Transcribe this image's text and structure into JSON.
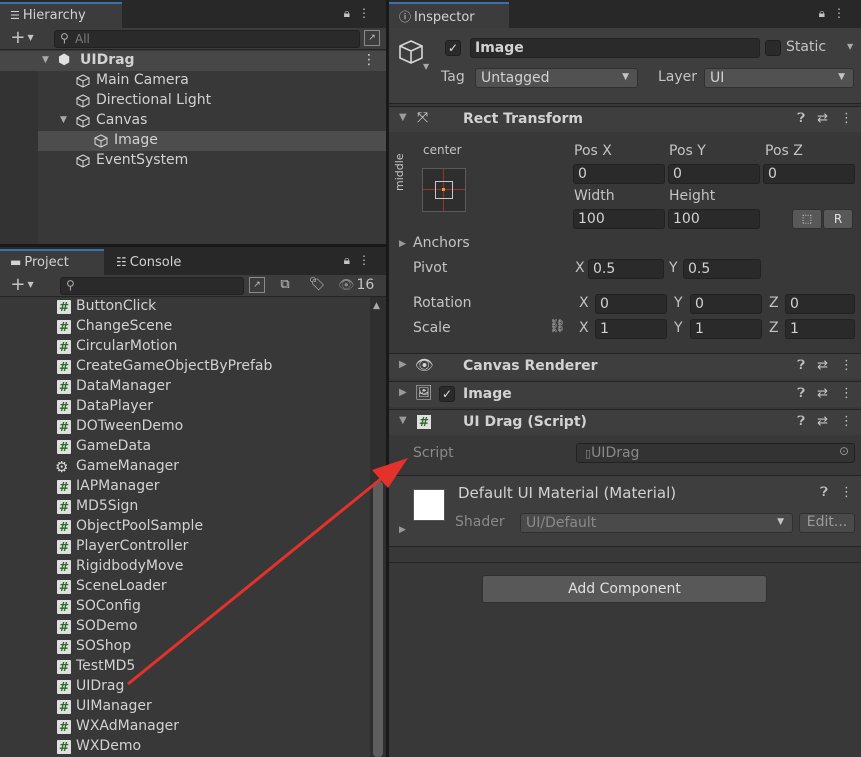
{
  "colors": {
    "selection": "#4d4d4d",
    "tab_accent": "#3a72b0",
    "arrow": "#e3312b",
    "script_icon_green": "#2a6b2a"
  },
  "hierarchy": {
    "tab_label": "Hierarchy",
    "search_placeholder": "All",
    "add_label": "+",
    "scene_name": "UIDrag",
    "items": [
      {
        "label": "Main Camera",
        "icon": "gameobject-cube-icon"
      },
      {
        "label": "Directional Light",
        "icon": "gameobject-cube-icon"
      },
      {
        "label": "Canvas",
        "icon": "gameobject-cube-icon"
      },
      {
        "label": "Image",
        "icon": "gameobject-cube-icon"
      },
      {
        "label": "EventSystem",
        "icon": "gameobject-cube-icon"
      }
    ]
  },
  "project": {
    "tab_label": "Project",
    "console_tab_label": "Console",
    "hidden_count": "16",
    "add_label": "+",
    "files": [
      {
        "label": "ButtonClick",
        "icon": "csharp-script-icon"
      },
      {
        "label": "ChangeScene",
        "icon": "csharp-script-icon"
      },
      {
        "label": "CircularMotion",
        "icon": "csharp-script-icon"
      },
      {
        "label": "CreateGameObjectByPrefab",
        "icon": "csharp-script-icon"
      },
      {
        "label": "DataManager",
        "icon": "csharp-script-icon"
      },
      {
        "label": "DataPlayer",
        "icon": "csharp-script-icon"
      },
      {
        "label": "DOTweenDemo",
        "icon": "csharp-script-icon"
      },
      {
        "label": "GameData",
        "icon": "csharp-script-icon"
      },
      {
        "label": "GameManager",
        "icon": "gear-icon"
      },
      {
        "label": "IAPManager",
        "icon": "csharp-script-icon"
      },
      {
        "label": "MD5Sign",
        "icon": "csharp-script-icon"
      },
      {
        "label": "ObjectPoolSample",
        "icon": "csharp-script-icon"
      },
      {
        "label": "PlayerController",
        "icon": "csharp-script-icon"
      },
      {
        "label": "RigidbodyMove",
        "icon": "csharp-script-icon"
      },
      {
        "label": "SceneLoader",
        "icon": "csharp-script-icon"
      },
      {
        "label": "SOConfig",
        "icon": "csharp-script-icon"
      },
      {
        "label": "SODemo",
        "icon": "csharp-script-icon"
      },
      {
        "label": "SOShop",
        "icon": "csharp-script-icon"
      },
      {
        "label": "TestMD5",
        "icon": "csharp-script-icon"
      },
      {
        "label": "UIDrag",
        "icon": "csharp-script-icon"
      },
      {
        "label": "UIManager",
        "icon": "csharp-script-icon"
      },
      {
        "label": "WXAdManager",
        "icon": "csharp-script-icon"
      },
      {
        "label": "WXDemo",
        "icon": "csharp-script-icon"
      }
    ]
  },
  "inspector": {
    "tab_label": "Inspector",
    "object_name": "Image",
    "static_label": "Static",
    "tag_label": "Tag",
    "tag_value": "Untagged",
    "layer_label": "Layer",
    "layer_value": "UI",
    "rect_transform": {
      "title": "Rect Transform",
      "anchor_h": "center",
      "anchor_v": "middle",
      "pos_x_label": "Pos X",
      "pos_x": "0",
      "pos_y_label": "Pos Y",
      "pos_y": "0",
      "pos_z_label": "Pos Z",
      "pos_z": "0",
      "width_label": "Width",
      "width": "100",
      "height_label": "Height",
      "height": "100",
      "r_button": "R",
      "anchors_label": "Anchors",
      "pivot_label": "Pivot",
      "pivot_x": "0.5",
      "pivot_y": "0.5",
      "rotation_label": "Rotation",
      "rot_x": "0",
      "rot_y": "0",
      "rot_z": "0",
      "scale_label": "Scale",
      "scale_x": "1",
      "scale_y": "1",
      "scale_z": "1",
      "x_label": "X",
      "y_label": "Y",
      "z_label": "Z"
    },
    "canvas_renderer_title": "Canvas Renderer",
    "image_title": "Image",
    "ui_drag": {
      "title": "UI Drag (Script)",
      "script_label": "Script",
      "script_value": "UIDrag"
    },
    "material": {
      "title": "Default UI Material (Material)",
      "shader_label": "Shader",
      "shader_value": "UI/Default",
      "edit_label": "Edit..."
    },
    "add_component_label": "Add Component"
  }
}
